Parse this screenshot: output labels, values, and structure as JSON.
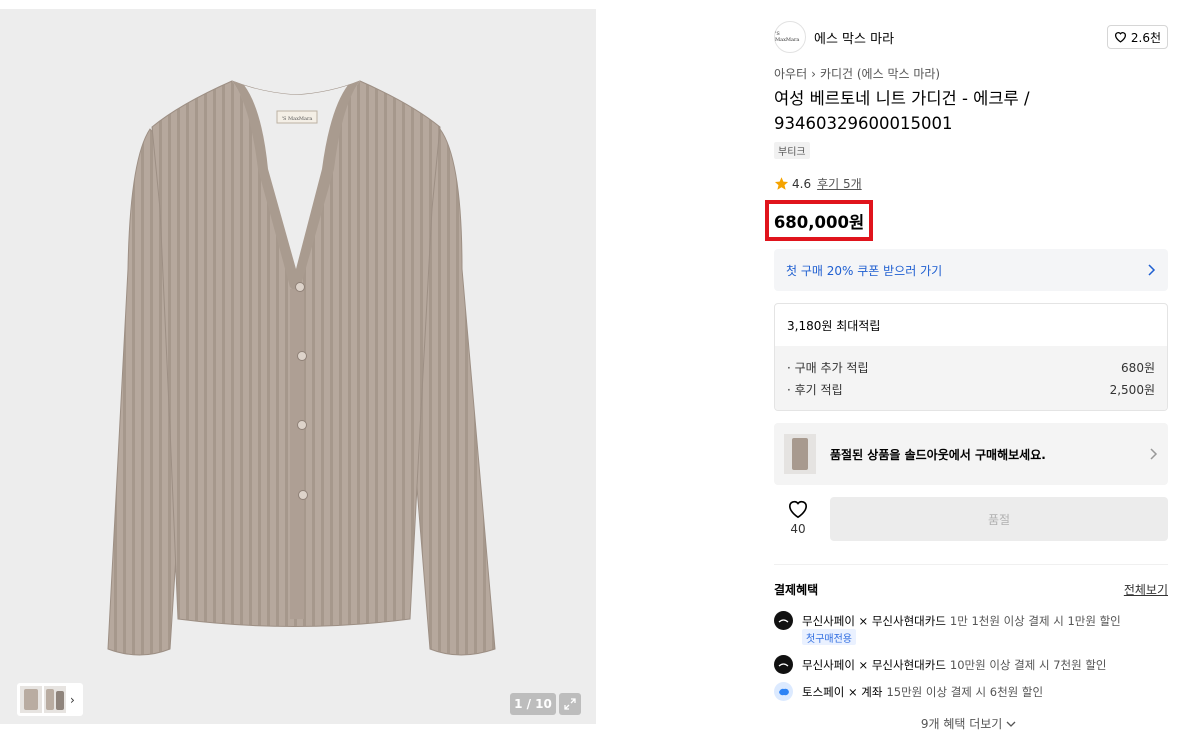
{
  "gallery": {
    "counter": "1 / 10",
    "thumb_next": "›"
  },
  "brand": {
    "logo_text": "'S MaxMara",
    "name": "에스 막스 마라",
    "likes": "2.6천"
  },
  "breadcrumb": {
    "category": "아우터",
    "sep": "›",
    "subcategory": "카디건 (에스 막스 마라)"
  },
  "product": {
    "title": "여성 베르토네 니트 가디건 - 에크루 / 93460329600015001",
    "tag": "부티크",
    "rating": "4.6",
    "reviews": "후기 5개",
    "price": "680,000원"
  },
  "coupon": {
    "label": "첫 구매 20% 쿠폰 받으러 가기"
  },
  "points": {
    "title": "3,180원 최대적립",
    "rows": [
      {
        "label": "· 구매 추가 적립",
        "value": "680원"
      },
      {
        "label": "· 후기 적립",
        "value": "2,500원"
      }
    ]
  },
  "soldout": {
    "text": "품절된 상품을 솔드아웃에서 구매해보세요."
  },
  "wish": {
    "count": "40"
  },
  "buy_button": {
    "label": "품절"
  },
  "benefits": {
    "title": "결제혜택",
    "view_all": "전체보기",
    "items": [
      {
        "name": "무신사페이 × 무신사현대카드",
        "desc": "1만 1천원 이상 결제 시 1만원 할인",
        "tag": "첫구매전용"
      },
      {
        "name": "무신사페이 × 무신사현대카드",
        "desc": "10만원 이상 결제 시 7천원 할인"
      },
      {
        "name": "토스페이 × 계좌",
        "desc": "15만원 이상 결제 시 6천원 할인"
      }
    ],
    "more": "9개 혜택 더보기"
  },
  "colors": {
    "price_highlight": "#e0141c",
    "coupon_blue": "#1f5fd1",
    "cardigan": "#b5a79b",
    "star": "#f5a300"
  }
}
